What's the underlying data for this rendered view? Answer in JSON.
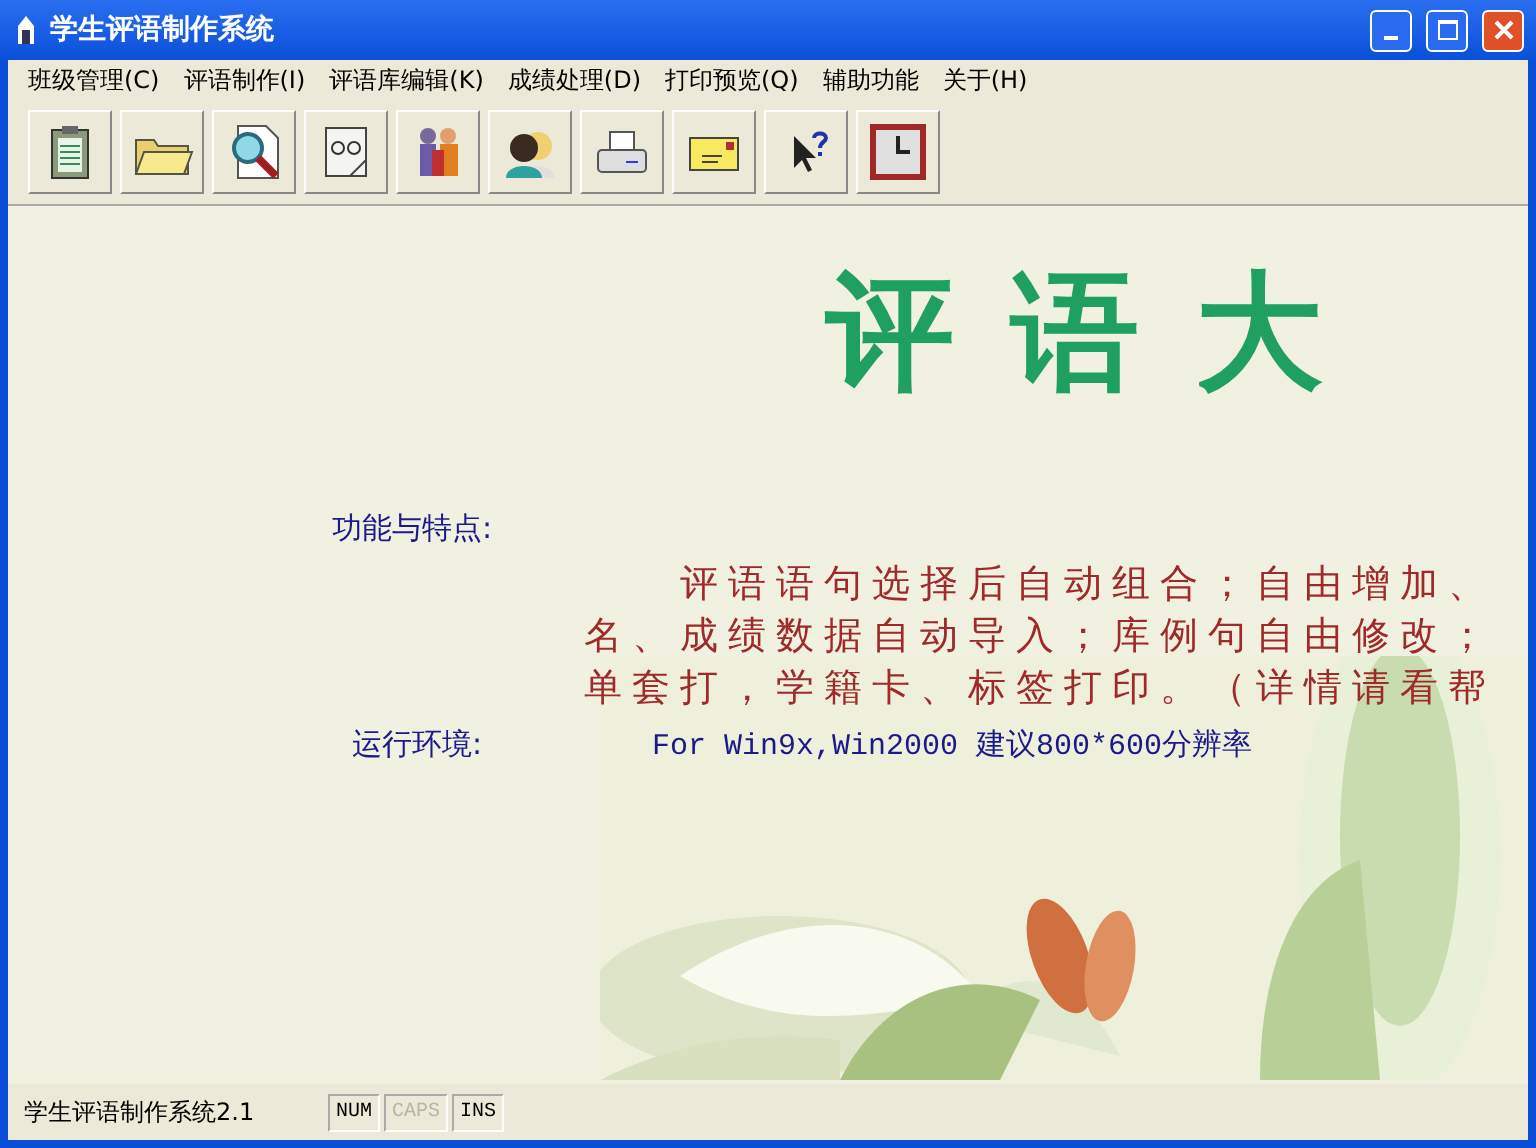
{
  "window": {
    "title": "学生评语制作系统"
  },
  "menu": [
    "班级管理(C)",
    "评语制作(I)",
    "评语库编辑(K)",
    "成绩处理(D)",
    "打印预览(Q)",
    "辅助功能",
    "关于(H)"
  ],
  "toolbar": [
    {
      "kind": "clipboard"
    },
    {
      "kind": "folder"
    },
    {
      "kind": "magnifier"
    },
    {
      "kind": "glasses"
    },
    {
      "kind": "people"
    },
    {
      "kind": "faces"
    },
    {
      "kind": "printer"
    },
    {
      "kind": "envelope"
    },
    {
      "kind": "help"
    },
    {
      "kind": "clock"
    }
  ],
  "banner": "评 语 大",
  "features": {
    "label": "功能与特点:",
    "lines": [
      "评语语句选择后自动组合；自由增加、",
      "名、成绩数据自动导入；库例句自由修改；",
      "单套打，学籍卡、标签打印。（详情请看帮"
    ]
  },
  "environment": {
    "label": "运行环境:",
    "value": "For Win9x,Win2000 建议800*600分辨率"
  },
  "status_bar": {
    "text": "学生评语制作系统2.1",
    "indicators": [
      {
        "label": "NUM",
        "disabled": false
      },
      {
        "label": "CAPS",
        "disabled": true
      },
      {
        "label": "INS",
        "disabled": false
      }
    ]
  }
}
